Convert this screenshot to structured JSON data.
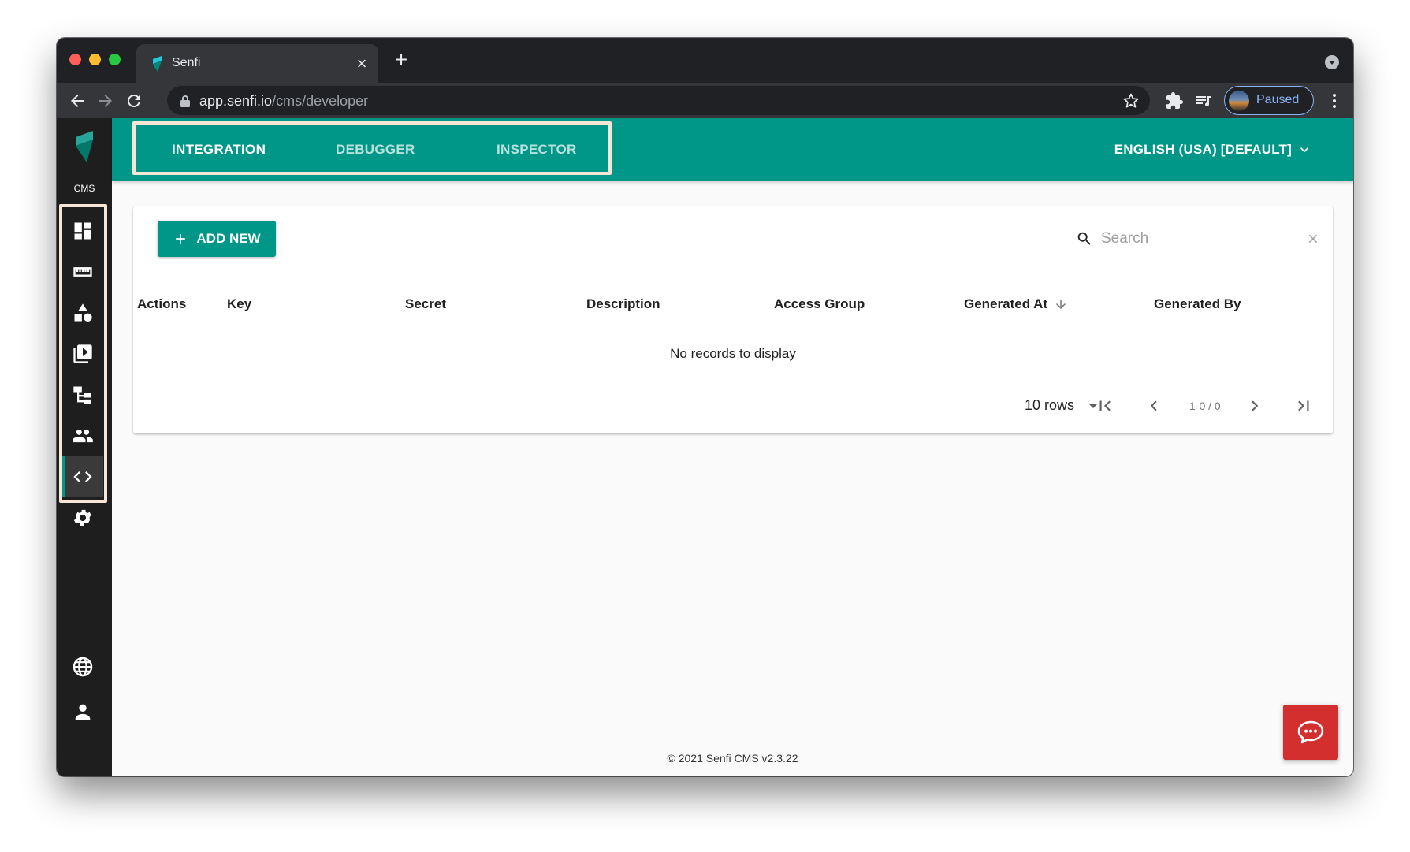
{
  "browser": {
    "tab_title": "Senfi",
    "url_host": "app.senfi.io",
    "url_path": "/cms/developer",
    "profile_label": "Paused"
  },
  "sidebar": {
    "logo_label": "CMS",
    "items": [
      {
        "icon": "dashboard-icon"
      },
      {
        "icon": "ruler-icon"
      },
      {
        "icon": "shapes-icon"
      },
      {
        "icon": "video-library-icon"
      },
      {
        "icon": "hierarchy-icon"
      },
      {
        "icon": "people-icon"
      },
      {
        "icon": "code-icon"
      },
      {
        "icon": "gear-icon"
      },
      {
        "icon": "globe-icon"
      },
      {
        "icon": "person-icon"
      }
    ]
  },
  "topbar": {
    "tabs": [
      {
        "label": "INTEGRATION",
        "active": true
      },
      {
        "label": "DEBUGGER",
        "active": false
      },
      {
        "label": "INSPECTOR",
        "active": false
      }
    ],
    "language": "ENGLISH (USA) [DEFAULT]"
  },
  "content": {
    "add_button": "ADD NEW",
    "search_placeholder": "Search",
    "columns": [
      "Actions",
      "Key",
      "Secret",
      "Description",
      "Access Group",
      "Generated At",
      "Generated By"
    ],
    "empty_message": "No records to display",
    "rows_per_page": "10 rows",
    "page_info": "1-0 / 0"
  },
  "footer": "© 2021 Senfi CMS v2.3.22",
  "colors": {
    "accent": "#009688",
    "sidebar": "#1e1e1e",
    "chat": "#d32f2f",
    "highlight": "#f6e6d6"
  }
}
